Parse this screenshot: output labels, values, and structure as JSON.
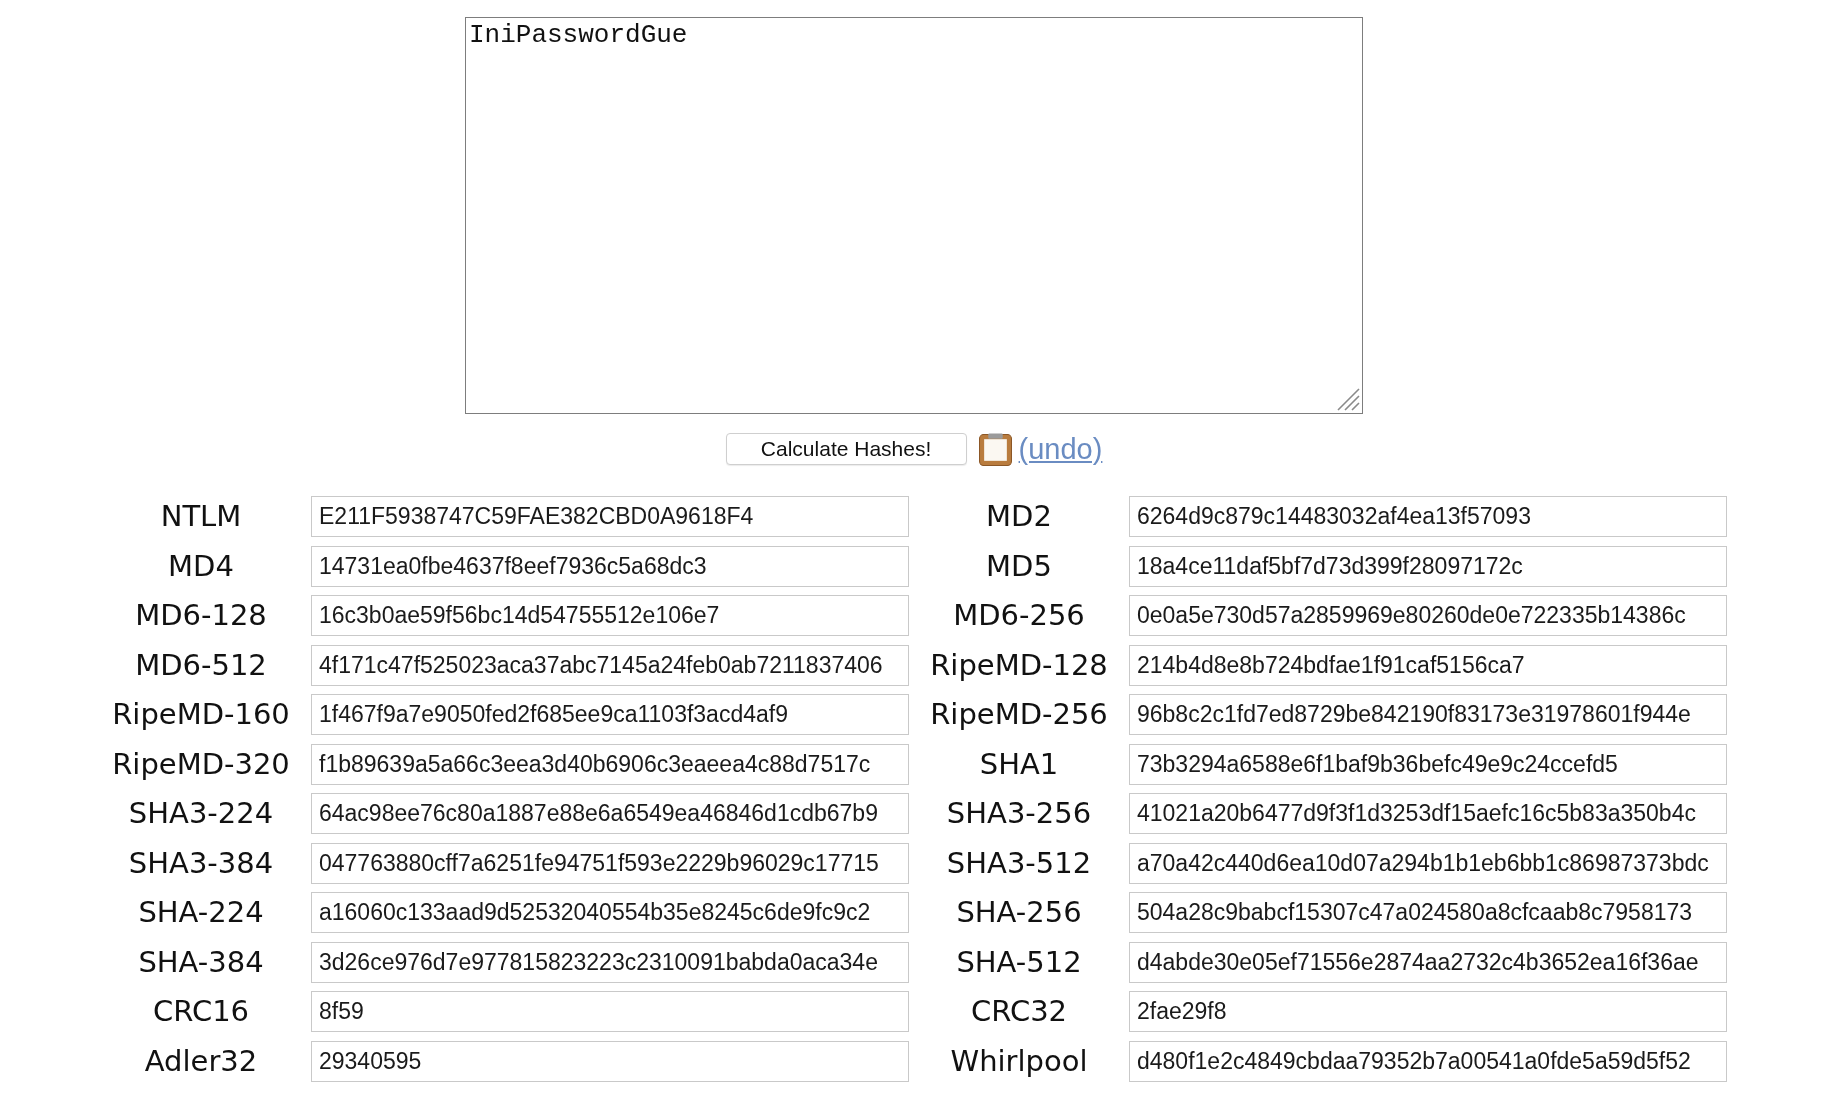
{
  "text_input": {
    "value": "IniPasswordGue"
  },
  "actions": {
    "button": "Calculate Hashes!",
    "undo_link": "(undo)"
  },
  "hashes": [
    {
      "label": "NTLM",
      "value": "E211F5938747C59FAE382CBD0A9618F4"
    },
    {
      "label": "MD2",
      "value": "6264d9c879c14483032af4ea13f57093"
    },
    {
      "label": "MD4",
      "value": "14731ea0fbe4637f8eef7936c5a68dc3"
    },
    {
      "label": "MD5",
      "value": "18a4ce11daf5bf7d73d399f28097172c"
    },
    {
      "label": "MD6-128",
      "value": "16c3b0ae59f56bc14d54755512e106e7"
    },
    {
      "label": "MD6-256",
      "value": "0e0a5e730d57a2859969e80260de0e722335b14386c"
    },
    {
      "label": "MD6-512",
      "value": "4f171c47f525023aca37abc7145a24feb0ab7211837406"
    },
    {
      "label": "RipeMD-128",
      "value": "214b4d8e8b724bdfae1f91caf5156ca7"
    },
    {
      "label": "RipeMD-160",
      "value": "1f467f9a7e9050fed2f685ee9ca1103f3acd4af9"
    },
    {
      "label": "RipeMD-256",
      "value": "96b8c2c1fd7ed8729be842190f83173e31978601f944e"
    },
    {
      "label": "RipeMD-320",
      "value": "f1b89639a5a66c3eea3d40b6906c3eaeea4c88d7517c"
    },
    {
      "label": "SHA1",
      "value": "73b3294a6588e6f1baf9b36befc49e9c24ccefd5"
    },
    {
      "label": "SHA3-224",
      "value": "64ac98ee76c80a1887e88e6a6549ea46846d1cdb67b9"
    },
    {
      "label": "SHA3-256",
      "value": "41021a20b6477d9f3f1d3253df15aefc16c5b83a350b4c"
    },
    {
      "label": "SHA3-384",
      "value": "047763880cff7a6251fe94751f593e2229b96029c17715"
    },
    {
      "label": "SHA3-512",
      "value": "a70a42c440d6ea10d07a294b1b1eb6bb1c86987373bdc"
    },
    {
      "label": "SHA-224",
      "value": "a16060c133aad9d52532040554b35e8245c6de9fc9c2"
    },
    {
      "label": "SHA-256",
      "value": "504a28c9babcf15307c47a024580a8cfcaab8c7958173"
    },
    {
      "label": "SHA-384",
      "value": "3d26ce976d7e977815823223c2310091babda0aca34e"
    },
    {
      "label": "SHA-512",
      "value": "d4abde30e05ef71556e2874aa2732c4b3652ea16f36ae"
    },
    {
      "label": "CRC16",
      "value": "8f59"
    },
    {
      "label": "CRC32",
      "value": "2fae29f8"
    },
    {
      "label": "Adler32",
      "value": "29340595"
    },
    {
      "label": "Whirlpool",
      "value": "d480f1e2c4849cbdaa79352b7a00541a0fde5a59d5f52"
    }
  ]
}
